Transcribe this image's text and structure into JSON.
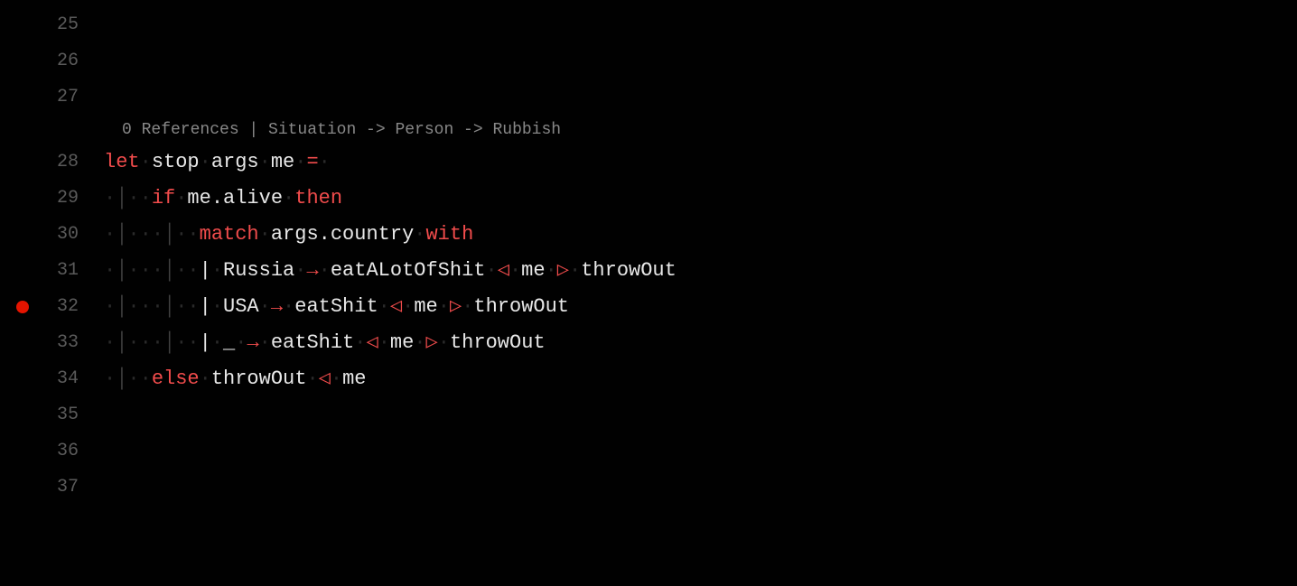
{
  "lineNumbers": [
    "25",
    "26",
    "27",
    "28",
    "29",
    "30",
    "31",
    "32",
    "33",
    "34",
    "35",
    "36",
    "37"
  ],
  "breakpointLine": "32",
  "codelens": "0 References | Situation -> Person -> Rubbish",
  "tokens": {
    "let": "let",
    "stop": "stop",
    "args": "args",
    "me": "me",
    "eq": "=",
    "if": "if",
    "me_alive": "me.alive",
    "then": "then",
    "match": "match",
    "args_country": "args.country",
    "with": "with",
    "pipe": "|",
    "russia": "Russia",
    "usa": "USA",
    "underscore": "_",
    "arrow": "→",
    "eatALot": "eatALotOfShit",
    "eatShit": "eatShit",
    "throwOut": "throwOut",
    "triL": "◁",
    "triR": "▷",
    "else": "else"
  },
  "dot": "·",
  "guide": "│"
}
